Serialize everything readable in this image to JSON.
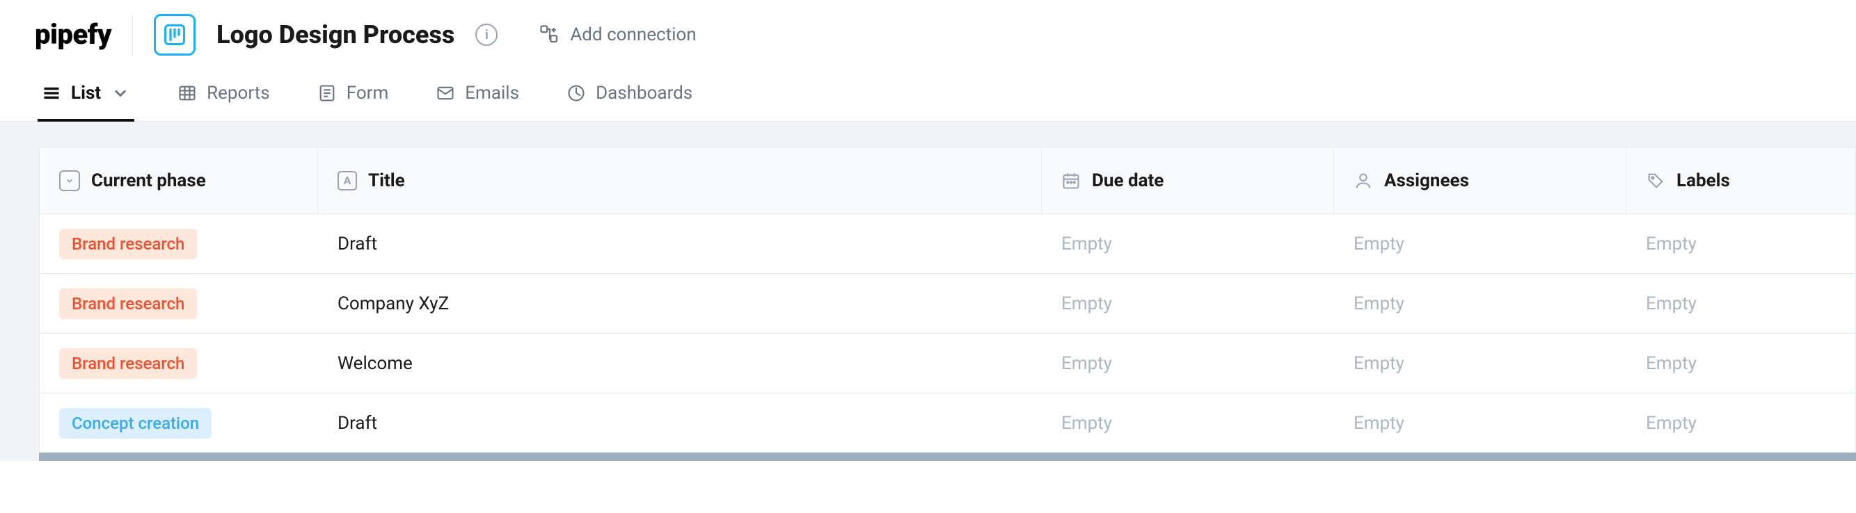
{
  "app": {
    "brand": "pipefy",
    "pipe_title": "Logo Design Process",
    "add_connection_label": "Add connection"
  },
  "tabs": [
    {
      "id": "list",
      "label": "List",
      "active": true,
      "has_chevron": true
    },
    {
      "id": "reports",
      "label": "Reports",
      "active": false
    },
    {
      "id": "form",
      "label": "Form",
      "active": false
    },
    {
      "id": "emails",
      "label": "Emails",
      "active": false
    },
    {
      "id": "dashboards",
      "label": "Dashboards",
      "active": false
    }
  ],
  "table": {
    "columns": {
      "phase": "Current phase",
      "title": "Title",
      "due_date": "Due date",
      "assignees": "Assignees",
      "labels": "Labels"
    },
    "empty_text": "Empty",
    "phase_styles": {
      "Brand research": "phase-brand-research",
      "Concept creation": "phase-concept-creation"
    },
    "rows": [
      {
        "phase": "Brand research",
        "title": "Draft",
        "due_date": null,
        "assignees": null,
        "labels": null
      },
      {
        "phase": "Brand research",
        "title": "Company XyZ",
        "due_date": null,
        "assignees": null,
        "labels": null
      },
      {
        "phase": "Brand research",
        "title": "Welcome",
        "due_date": null,
        "assignees": null,
        "labels": null
      },
      {
        "phase": "Concept creation",
        "title": "Draft",
        "due_date": null,
        "assignees": null,
        "labels": null
      }
    ]
  }
}
